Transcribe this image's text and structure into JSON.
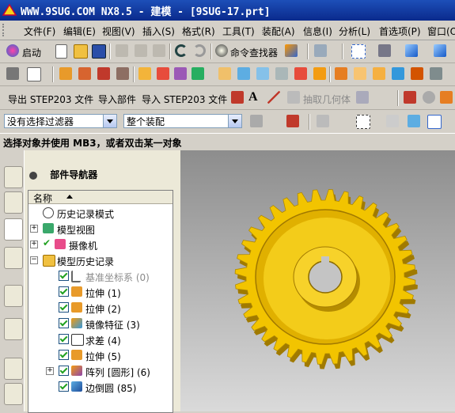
{
  "window": {
    "title": "WWW.9SUG.COM NX8.5 - 建模 - [9SUG-17.prt]"
  },
  "menu": [
    "文件(F)",
    "编辑(E)",
    "视图(V)",
    "插入(S)",
    "格式(R)",
    "工具(T)",
    "装配(A)",
    "信息(I)",
    "分析(L)",
    "首选项(P)",
    "窗口(O)"
  ],
  "toolbar1": {
    "start_label": "启动",
    "command_finder_label": "命令查找器"
  },
  "toolbar3": {
    "export_step": "导出 STEP203 文件",
    "import_part": "导入部件",
    "import_step": "导入 STEP203 文件",
    "extract_geom": "抽取几何体"
  },
  "selection": {
    "filter_value": "没有选择过滤器",
    "scope_value": "整个装配"
  },
  "status": {
    "prompt": "选择对象并使用 MB3，或者双击某一对象"
  },
  "navigator": {
    "title": "部件导航器",
    "column_name": "名称",
    "items": [
      {
        "label": "历史记录模式"
      },
      {
        "label": "模型视图"
      },
      {
        "label": "摄像机"
      },
      {
        "label": "模型历史记录"
      },
      {
        "label": "基准坐标系 (0)"
      },
      {
        "label": "拉伸 (1)"
      },
      {
        "label": "拉伸 (2)"
      },
      {
        "label": "镜像特征 (3)"
      },
      {
        "label": "求差 (4)"
      },
      {
        "label": "拉伸 (5)"
      },
      {
        "label": "阵列 [圆形] (6)"
      },
      {
        "label": "边倒圆 (85)"
      }
    ]
  },
  "colors": {
    "title_bar": "#0a2a8c",
    "gear": "#f2c400",
    "viewport_top": "#8d8d8d",
    "viewport_bottom": "#dadada"
  },
  "icons": [
    "nx-logo-icon",
    "start-icon",
    "new-file-icon",
    "open-file-icon",
    "save-icon",
    "cut-icon",
    "copy-icon",
    "paste-icon",
    "undo-icon",
    "redo-icon",
    "command-finder-icon",
    "selection-filter-icon"
  ]
}
